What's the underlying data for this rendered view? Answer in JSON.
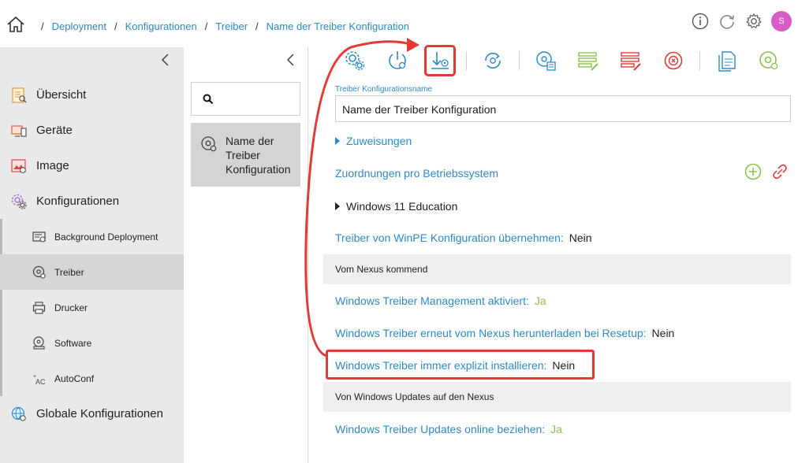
{
  "breadcrumb": [
    "Deployment",
    "Konfigurationen",
    "Treiber",
    "Name der Treiber Konfiguration"
  ],
  "user": {
    "avatar_letter": "S"
  },
  "sidebar": {
    "items": [
      {
        "label": "Übersicht",
        "icon": "overview-icon"
      },
      {
        "label": "Geräte",
        "icon": "devices-icon"
      },
      {
        "label": "Image",
        "icon": "image-icon"
      },
      {
        "label": "Konfigurationen",
        "icon": "configurations-icon"
      }
    ],
    "subitems": [
      {
        "label": "Background Deployment",
        "icon": "background-deployment-icon"
      },
      {
        "label": "Treiber",
        "icon": "driver-icon",
        "active": true
      },
      {
        "label": "Drucker",
        "icon": "printer-icon"
      },
      {
        "label": "Software",
        "icon": "software-icon"
      },
      {
        "label": "AutoConf",
        "icon": "autoconf-icon"
      }
    ],
    "global": {
      "label": "Globale Konfigurationen",
      "icon": "globe-gear-icon"
    }
  },
  "list": {
    "selected_item": "Name der Treiber Konfiguration"
  },
  "form": {
    "name_label": "Treiber Konfigurationsname",
    "name_value": "Name der Treiber Konfiguration",
    "assignments": "Zuweisungen",
    "os_mappings": "Zuordnungen pro Betriebssystem",
    "os_entry": "Windows 11 Education",
    "winpe_label": "Treiber von WinPE Konfiguration übernehmen:",
    "winpe_value": "Nein",
    "section_nexus": "Vom Nexus kommend",
    "mgmt_label": "Windows Treiber Management aktiviert:",
    "mgmt_value": "Ja",
    "redownload_label": "Windows Treiber erneut vom Nexus herunterladen bei Resetup:",
    "redownload_value": "Nein",
    "explicit_label": "Windows Treiber immer explizit installieren:",
    "explicit_value": "Nein",
    "section_updates": "Von Windows Updates auf den Nexus",
    "online_label": "Windows Treiber Updates online beziehen:",
    "online_value": "Ja"
  },
  "colors": {
    "accent": "#2b8ccb",
    "green": "#8bc34a",
    "red": "#e53935",
    "avatar": "#d85cc6"
  }
}
